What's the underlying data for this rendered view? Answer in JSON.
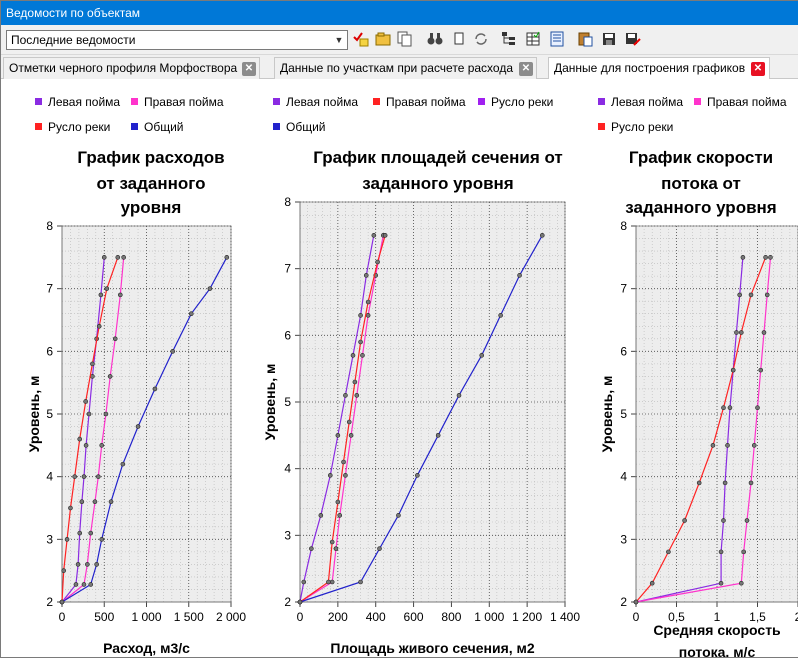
{
  "window": {
    "title": "Ведомости по объектам"
  },
  "toolbar": {
    "combo_value": "Последние ведомости",
    "icons": [
      "checkmark-list-icon",
      "folder-icon",
      "copy-icon",
      "binoculars-icon",
      "page-icon",
      "refresh-icon",
      "tree-icon",
      "table-icon",
      "document-icon",
      "paste-icon",
      "save-icon",
      "save-as-icon"
    ]
  },
  "tabs": [
    {
      "label": "Отметки черного профиля Морфоствора",
      "active": false
    },
    {
      "label": "Данные по участкам при расчете расхода",
      "active": false
    },
    {
      "label": "Данные для построения графиков",
      "active": true
    }
  ],
  "colors": {
    "left": "#8a2be2",
    "right": "#ff33cc",
    "river": "#ff2222",
    "total": "#2222cc",
    "titlebar": "#0078d7"
  },
  "chart_data": [
    {
      "type": "line",
      "title": "График расходов от заданного уровня",
      "title_lines": [
        "График расходов",
        "от заданного",
        "уровня"
      ],
      "xlabel": "Расход, м3/с",
      "ylabel": "Уровень, м",
      "xlim": [
        0,
        2000
      ],
      "ylim": [
        2,
        8
      ],
      "xticks": [
        0,
        500,
        1000,
        1500,
        2000
      ],
      "xtick_labels": [
        "0",
        "500",
        "1 000",
        "1 500",
        "2 000"
      ],
      "yticks": [
        2,
        3,
        4,
        5,
        6,
        7,
        8
      ],
      "ytick_labels": [
        "2",
        "3",
        "4",
        "5",
        "6",
        "7",
        "8"
      ],
      "legend": [
        "Левая пойма",
        "Правая пойма",
        "Русло реки",
        "Общий"
      ],
      "series": [
        {
          "name": "Левая пойма",
          "color": "#8a2be2",
          "points": [
            [
              0,
              2
            ],
            [
              165,
              2.28
            ],
            [
              190,
              2.6
            ],
            [
              210,
              3.1
            ],
            [
              235,
              3.6
            ],
            [
              260,
              4.0
            ],
            [
              285,
              4.5
            ],
            [
              320,
              5.0
            ],
            [
              360,
              5.6
            ],
            [
              410,
              6.2
            ],
            [
              460,
              6.9
            ],
            [
              500,
              7.5
            ]
          ]
        },
        {
          "name": "Правая пойма",
          "color": "#ff33cc",
          "points": [
            [
              0,
              2
            ],
            [
              260,
              2.28
            ],
            [
              300,
              2.6
            ],
            [
              340,
              3.1
            ],
            [
              390,
              3.6
            ],
            [
              430,
              4.0
            ],
            [
              470,
              4.5
            ],
            [
              520,
              5.0
            ],
            [
              570,
              5.6
            ],
            [
              630,
              6.2
            ],
            [
              690,
              6.9
            ],
            [
              730,
              7.5
            ]
          ]
        },
        {
          "name": "Русло реки",
          "color": "#ff2222",
          "points": [
            [
              0,
              2
            ],
            [
              20,
              2.5
            ],
            [
              60,
              3.0
            ],
            [
              100,
              3.5
            ],
            [
              150,
              4.0
            ],
            [
              210,
              4.6
            ],
            [
              280,
              5.2
            ],
            [
              360,
              5.8
            ],
            [
              440,
              6.4
            ],
            [
              530,
              7.0
            ],
            [
              660,
              7.5
            ]
          ]
        },
        {
          "name": "Общий",
          "color": "#2222cc",
          "points": [
            [
              0,
              2
            ],
            [
              340,
              2.28
            ],
            [
              410,
              2.6
            ],
            [
              470,
              3.0
            ],
            [
              580,
              3.6
            ],
            [
              720,
              4.2
            ],
            [
              900,
              4.8
            ],
            [
              1100,
              5.4
            ],
            [
              1310,
              6.0
            ],
            [
              1530,
              6.6
            ],
            [
              1750,
              7.0
            ],
            [
              1950,
              7.5
            ]
          ]
        }
      ]
    },
    {
      "type": "line",
      "title": "График площадей сечения от заданного уровня",
      "title_lines": [
        "График площадей сечения от",
        "заданного уровня"
      ],
      "xlabel": "Площадь живого сечения, м2",
      "ylabel": "Уровень, м",
      "xlim": [
        0,
        1400
      ],
      "ylim": [
        2,
        8
      ],
      "xticks": [
        0,
        200,
        400,
        600,
        800,
        1000,
        1200,
        1400
      ],
      "xtick_labels": [
        "0",
        "200",
        "400",
        "600",
        "800",
        "1 000",
        "1 200",
        "1 400"
      ],
      "yticks": [
        2,
        3,
        4,
        5,
        6,
        7,
        8
      ],
      "ytick_labels": [
        "2",
        "3",
        "4",
        "5",
        "6",
        "7",
        "8"
      ],
      "legend": [
        "Левая пойма",
        "Правая пойма",
        "Русло реки",
        "Общий"
      ],
      "series": [
        {
          "name": "Левая пойма",
          "color": "#8a2be2",
          "points": [
            [
              0,
              2
            ],
            [
              20,
              2.3
            ],
            [
              60,
              2.8
            ],
            [
              110,
              3.3
            ],
            [
              160,
              3.9
            ],
            [
              200,
              4.5
            ],
            [
              240,
              5.1
            ],
            [
              280,
              5.7
            ],
            [
              320,
              6.3
            ],
            [
              350,
              6.9
            ],
            [
              390,
              7.5
            ]
          ]
        },
        {
          "name": "Правая пойма",
          "color": "#ff33cc",
          "points": [
            [
              0,
              2
            ],
            [
              170,
              2.3
            ],
            [
              190,
              2.8
            ],
            [
              210,
              3.3
            ],
            [
              240,
              3.9
            ],
            [
              270,
              4.5
            ],
            [
              300,
              5.1
            ],
            [
              330,
              5.7
            ],
            [
              360,
              6.3
            ],
            [
              400,
              6.9
            ],
            [
              440,
              7.5
            ]
          ]
        },
        {
          "name": "Русло реки",
          "color": "#ff2222",
          "points": [
            [
              0,
              2
            ],
            [
              150,
              2.3
            ],
            [
              170,
              2.9
            ],
            [
              200,
              3.5
            ],
            [
              230,
              4.1
            ],
            [
              260,
              4.7
            ],
            [
              290,
              5.3
            ],
            [
              320,
              5.9
            ],
            [
              360,
              6.5
            ],
            [
              410,
              7.1
            ],
            [
              450,
              7.5
            ]
          ]
        },
        {
          "name": "Общий",
          "color": "#2222cc",
          "points": [
            [
              0,
              2
            ],
            [
              320,
              2.3
            ],
            [
              420,
              2.8
            ],
            [
              520,
              3.3
            ],
            [
              620,
              3.9
            ],
            [
              730,
              4.5
            ],
            [
              840,
              5.1
            ],
            [
              960,
              5.7
            ],
            [
              1060,
              6.3
            ],
            [
              1160,
              6.9
            ],
            [
              1280,
              7.5
            ]
          ]
        }
      ]
    },
    {
      "type": "line",
      "title": "График скорости потока от заданного уровня",
      "title_lines": [
        "График скорости",
        "потока от",
        "заданного уровня"
      ],
      "xlabel": "Средняя скорость потока, м/с",
      "xlabel_lines": [
        "Средняя скорость",
        "потока, м/с"
      ],
      "ylabel": "Уровень, м",
      "xlim": [
        0,
        2
      ],
      "ylim": [
        2,
        8
      ],
      "xticks": [
        0,
        0.5,
        1,
        1.5,
        2
      ],
      "xtick_labels": [
        "0",
        "0,5",
        "1",
        "1,5",
        "2"
      ],
      "yticks": [
        2,
        3,
        4,
        5,
        6,
        7,
        8
      ],
      "ytick_labels": [
        "2",
        "3",
        "4",
        "5",
        "6",
        "7",
        "8"
      ],
      "legend": [
        "Левая пойма",
        "Правая пойма",
        "Русло реки"
      ],
      "series": [
        {
          "name": "Левая пойма",
          "color": "#8a2be2",
          "points": [
            [
              0,
              2
            ],
            [
              1.05,
              2.3
            ],
            [
              1.05,
              2.8
            ],
            [
              1.08,
              3.3
            ],
            [
              1.1,
              3.9
            ],
            [
              1.13,
              4.5
            ],
            [
              1.16,
              5.1
            ],
            [
              1.2,
              5.7
            ],
            [
              1.24,
              6.3
            ],
            [
              1.28,
              6.9
            ],
            [
              1.32,
              7.5
            ]
          ]
        },
        {
          "name": "Правая пойма",
          "color": "#ff33cc",
          "points": [
            [
              0,
              2
            ],
            [
              1.3,
              2.3
            ],
            [
              1.33,
              2.8
            ],
            [
              1.37,
              3.3
            ],
            [
              1.42,
              3.9
            ],
            [
              1.46,
              4.5
            ],
            [
              1.5,
              5.1
            ],
            [
              1.54,
              5.7
            ],
            [
              1.58,
              6.3
            ],
            [
              1.62,
              6.9
            ],
            [
              1.66,
              7.5
            ]
          ]
        },
        {
          "name": "Русло реки",
          "color": "#ff2222",
          "points": [
            [
              0,
              2
            ],
            [
              0.2,
              2.3
            ],
            [
              0.4,
              2.8
            ],
            [
              0.6,
              3.3
            ],
            [
              0.78,
              3.9
            ],
            [
              0.95,
              4.5
            ],
            [
              1.08,
              5.1
            ],
            [
              1.2,
              5.7
            ],
            [
              1.3,
              6.3
            ],
            [
              1.42,
              6.9
            ],
            [
              1.6,
              7.5
            ]
          ]
        }
      ]
    }
  ]
}
